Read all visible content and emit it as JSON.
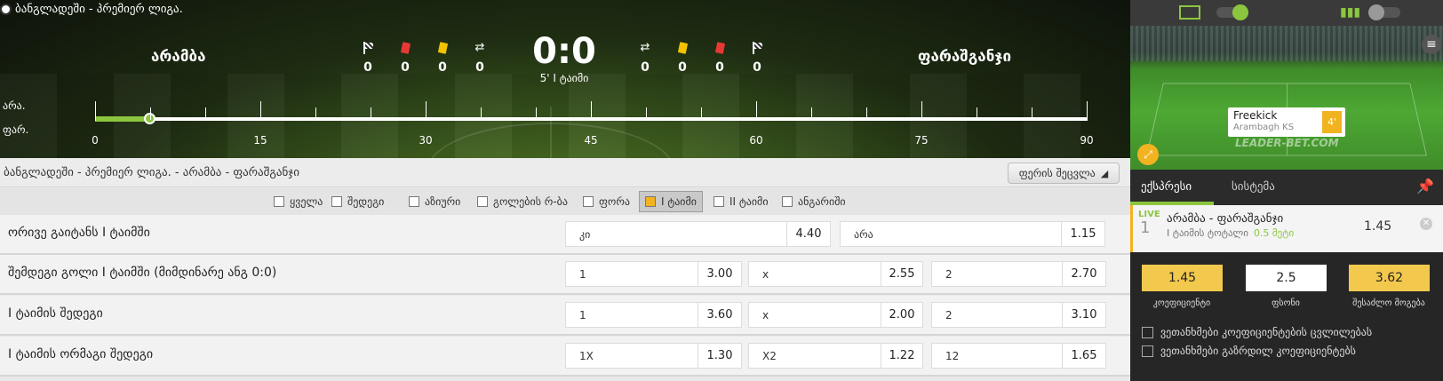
{
  "header": {
    "league": "ბანგლადეში - პრემიერ ლიგა.",
    "home_team": "არამბა",
    "away_team": "ფარაშგანჯი",
    "score": "0:0",
    "time": "5' I ტაიმი",
    "home_stats": [
      "0",
      "0",
      "0",
      "0"
    ],
    "away_stats": [
      "0",
      "0",
      "0",
      "0"
    ],
    "row_home": "არა.",
    "row_away": "ფარ.",
    "timeline_labels": [
      "0",
      "15",
      "30",
      "45",
      "60",
      "75",
      "90"
    ],
    "progress": 0.055
  },
  "breadcrumb": {
    "text": "ბანგლადეში - პრემიერ ლიგა. - არამბა - ფარაშგანჯი",
    "color_button": "ფერის შეცვლა"
  },
  "filters": [
    "ყველა",
    "შედეგი",
    "აზიური",
    "გოლების რ-ბა",
    "ფორა",
    "I ტაიმი",
    "II ტაიმი",
    "ანგარიში"
  ],
  "markets": [
    {
      "name": "ორივე გაიტანს I ტაიმში",
      "outcomes": [
        {
          "label": "კი",
          "odd": "4.40"
        },
        {
          "label": "არა",
          "odd": "1.15"
        }
      ]
    },
    {
      "name": "შემდეგი გოლი I ტაიმში (მიმდინარე ანგ 0:0)",
      "outcomes": [
        {
          "label": "1",
          "odd": "3.00"
        },
        {
          "label": "x",
          "odd": "2.55"
        },
        {
          "label": "2",
          "odd": "2.70"
        }
      ]
    },
    {
      "name": "I ტაიმის შედეგი",
      "outcomes": [
        {
          "label": "1",
          "odd": "3.60"
        },
        {
          "label": "x",
          "odd": "2.00"
        },
        {
          "label": "2",
          "odd": "3.10"
        }
      ]
    },
    {
      "name": "I ტაიმის ორმაგი შედეგი",
      "outcomes": [
        {
          "label": "1X",
          "odd": "1.30"
        },
        {
          "label": "X2",
          "odd": "1.22"
        },
        {
          "label": "12",
          "odd": "1.65"
        }
      ]
    }
  ],
  "right": {
    "event_name": "Freekick",
    "event_team": "Arambagh KS",
    "event_minute": "4'",
    "brand": "LEADER-BET.COM",
    "tabs": [
      "ექსპრესი",
      "სისტემა"
    ],
    "slip": {
      "live": "LIVE",
      "num": "1",
      "match": "არამბა - ფარაშგანჯი",
      "market": "I ტაიმის ტოტალი",
      "pick": "0.5 მეტი",
      "odd": "1.45"
    },
    "coef": "1.45",
    "stake": "2.5",
    "win": "3.62",
    "coef_label": "კოეფიციენტი",
    "stake_label": "ფსონი",
    "win_label": "შესაძლო მოგება",
    "check1": "ვეთანხმები კოეფიციენტების ცვლილებას",
    "check2": "ვეთანხმები გაზრდილ კოეფიციენტებს"
  },
  "colors": {
    "accent": "#8cc63f",
    "yellow": "#f2b320",
    "red": "#e53935"
  }
}
